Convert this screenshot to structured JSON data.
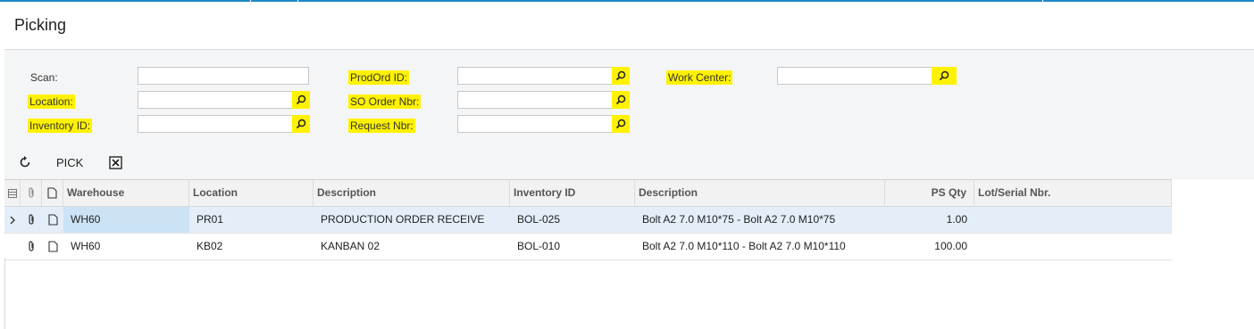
{
  "header": {
    "title": "Picking"
  },
  "form": {
    "scan_label": "Scan:",
    "scan_value": "",
    "location_label": "Location:",
    "location_value": "",
    "inventory_label": "Inventory ID:",
    "inventory_value": "",
    "prodord_label": "ProdOrd ID:",
    "prodord_value": "",
    "soorder_label": "SO Order Nbr:",
    "soorder_value": "",
    "request_label": "Request Nbr:",
    "request_value": "",
    "workcenter_label": "Work Center:",
    "workcenter_value": ""
  },
  "toolbar": {
    "refresh_icon": "refresh-icon",
    "pick_label": "PICK",
    "export_icon": "excel-export-icon"
  },
  "grid": {
    "columns": [
      "Warehouse",
      "Location",
      "Description",
      "Inventory ID",
      "Description",
      "PS Qty",
      "Lot/Serial Nbr."
    ],
    "rows": [
      {
        "warehouse": "WH60",
        "location": "PR01",
        "description": "PRODUCTION ORDER RECEIVE",
        "inventory_id": "BOL-025",
        "item_description": "Bolt A2 7.0 M10*75 - Bolt A2 7.0 M10*75",
        "ps_qty": "1.00",
        "lot_serial": ""
      },
      {
        "warehouse": "WH60",
        "location": "KB02",
        "description": "KANBAN 02",
        "inventory_id": "BOL-010",
        "item_description": "Bolt A2 7.0 M10*110 - Bolt A2 7.0 M10*110",
        "ps_qty": "100.00",
        "lot_serial": ""
      }
    ]
  },
  "colors": {
    "highlight": "#fff200",
    "top_bar": "#1e88c8",
    "selected_row": "#e3eef9"
  }
}
